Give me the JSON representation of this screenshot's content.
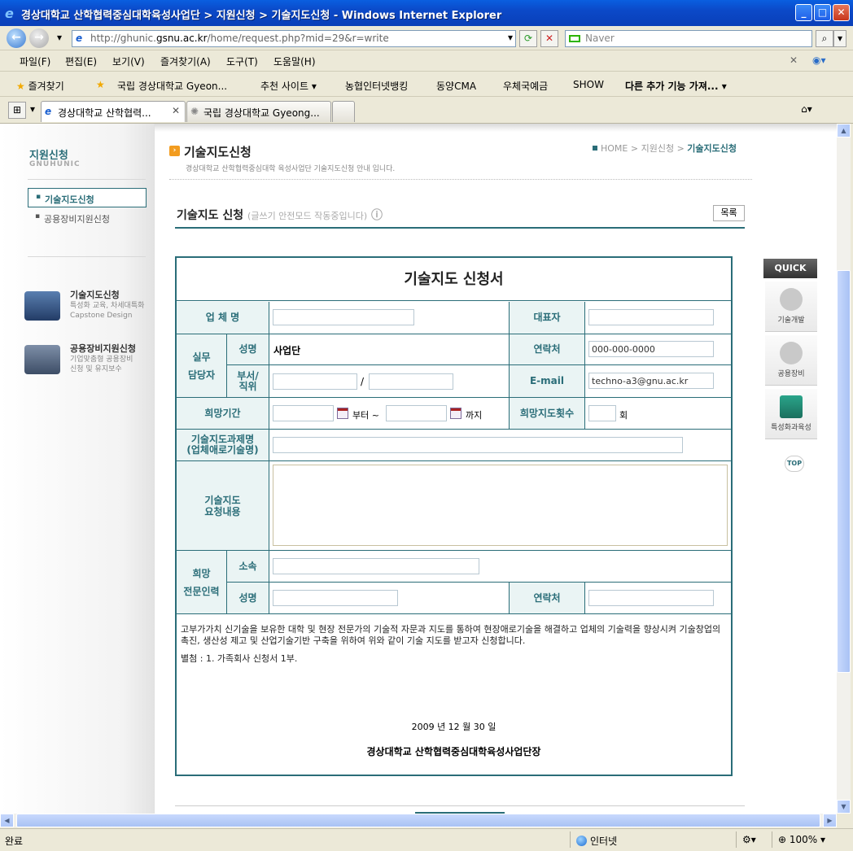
{
  "window": {
    "title": "경상대학교 산학협력중심대학육성사업단 > 지원신청 > 기술지도신청 - Windows Internet Explorer",
    "minimize": "_",
    "maximize": "□",
    "close": "✕"
  },
  "address": {
    "url_prefix": "http://ghunic.",
    "url_host": "gsnu.ac.kr",
    "url_suffix": "/home/request.php?mid=29&r=write",
    "search_placeholder": "Naver"
  },
  "menu": [
    "파일(F)",
    "편집(E)",
    "보기(V)",
    "즐겨찾기(A)",
    "도구(T)",
    "도움말(H)"
  ],
  "favorites": {
    "label": "즐겨찾기",
    "items": [
      "국립 경상대학교 Gyeon...",
      "추천 사이트 ▾",
      "농협인터넷뱅킹",
      "동양CMA",
      "우체국예금",
      "SHOW",
      "다른 추가 기능 가져... ▾"
    ]
  },
  "tabs": [
    {
      "label": "경상대학교 산학협력..."
    },
    {
      "label": "국립 경상대학교 Gyeong..."
    }
  ],
  "sidebar": {
    "title": "지원신청",
    "subtitle": "GNUHUNIC",
    "items": [
      {
        "label": "기술지도신청"
      },
      {
        "label": "공용장비지원신청"
      }
    ],
    "banners": [
      {
        "title": "기술지도신청",
        "line1": "특성화 교육, 차세대특화",
        "line2": "Capstone Design"
      },
      {
        "title": "공용장비지원신청",
        "line1": "기업맞춤형 공용장비",
        "line2": "신청 및 유지보수"
      }
    ]
  },
  "page": {
    "title": "기술지도신청",
    "desc": "경상대학교 산학협력중심대학 육성사업단 기술지도신청 안내 입니다.",
    "breadcrumb": {
      "home": "HOME",
      "sep1": " > ",
      "level1": "지원신청",
      "sep2": " > ",
      "current": "기술지도신청"
    }
  },
  "form": {
    "heading": "기술지도 신청",
    "note": "(글쓰기 안전모드 작동중입니다)",
    "list_button": "목록",
    "title": "기술지도 신청서",
    "labels": {
      "company": "업 체 명",
      "ceo": "대표자",
      "staff": "실무\n담당자",
      "name": "성명",
      "contact": "연락처",
      "dept": "부서/\n직위",
      "email": "E-mail",
      "period": "희망기간",
      "count": "희망지도횟수",
      "subject": "기술지도과제명\n(업체애로기술명)",
      "request": "기술지도\n요청내용",
      "expert": "희망\n전문인력",
      "affiliation": "소속",
      "expert_name": "성명",
      "expert_contact": "연락처"
    },
    "values": {
      "staff_name": "사업단",
      "contact": "000-000-0000",
      "email": "techno-a3@gnu.ac.kr",
      "slash": "/",
      "from": "부터 ~",
      "to": "까지",
      "times": "회"
    },
    "body": "고부가가치 신기술을 보유한 대학 및 현장 전문가의 기술적 자문과 지도를 통하여 현장애로기술을 해결하고 업체의 기술력을 향상시켜 기술창업의 촉진, 생산성 제고 및 산업기술기반 구축을 위하여 위와 같이 기술 지도를 받고자 신청합니다.",
    "attachment": "별첨 : 1. 가족회사 신청서 1부.",
    "date": "2009 년 12 월 30 일",
    "signature": "경상대학교 산학협력중심대학육성사업단장"
  },
  "quick": {
    "header": "QUICK",
    "items": [
      {
        "label": "기술개발"
      },
      {
        "label": "공용장비"
      },
      {
        "label": "특성화과육성"
      }
    ],
    "top": "TOP"
  },
  "status": {
    "text": "완료",
    "zone": "인터넷",
    "zoom": "100%"
  }
}
